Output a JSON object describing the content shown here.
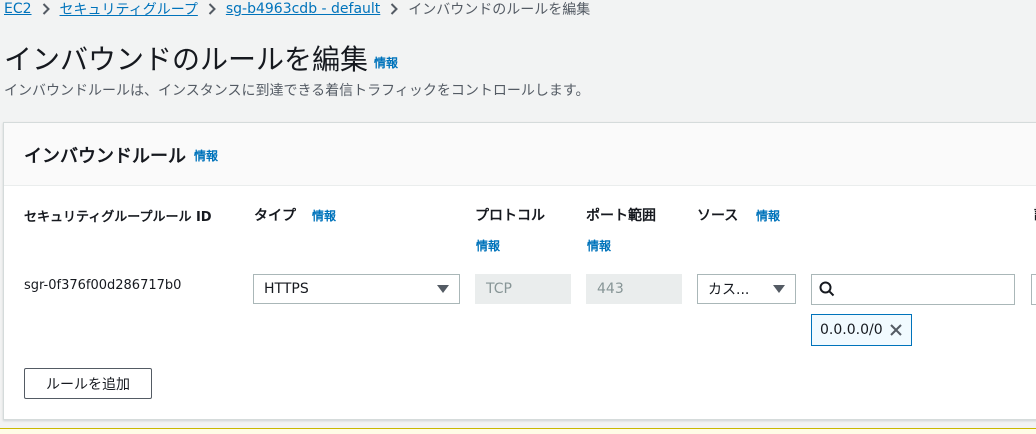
{
  "breadcrumb": {
    "items": [
      "EC2",
      "セキュリティグループ",
      "sg-b4963cdb - default"
    ],
    "current": "インバウンドのルールを編集"
  },
  "page": {
    "title": "インバウンドのルールを編集",
    "info": "情報",
    "description": "インバウンドルールは、インスタンスに到達できる着信トラフィックをコントロールします。"
  },
  "panel": {
    "title": "インバウンドルール",
    "info": "情報",
    "columns": {
      "rule_id": "セキュリティグループルール ID",
      "type": "タイプ",
      "type_info": "情報",
      "protocol": "プロトコル",
      "protocol_info": "情報",
      "port_range": "ポート範囲",
      "port_range_info": "情報",
      "source": "ソース",
      "source_info": "情報",
      "cut": "説"
    },
    "row": {
      "rule_id": "sgr-0f376f00d286717b0",
      "type": "HTTPS",
      "protocol": "TCP",
      "port_range": "443",
      "source_type": "カス...",
      "search_value": "",
      "token": "0.0.0.0/0"
    },
    "add_rule_label": "ルールを追加"
  },
  "icons": [
    "chevron-right-icon",
    "caret-down-icon",
    "search-icon",
    "close-icon"
  ],
  "colors": {
    "link": "#0073bb",
    "background": "#f2f3f3",
    "token_border": "#0073bb"
  }
}
